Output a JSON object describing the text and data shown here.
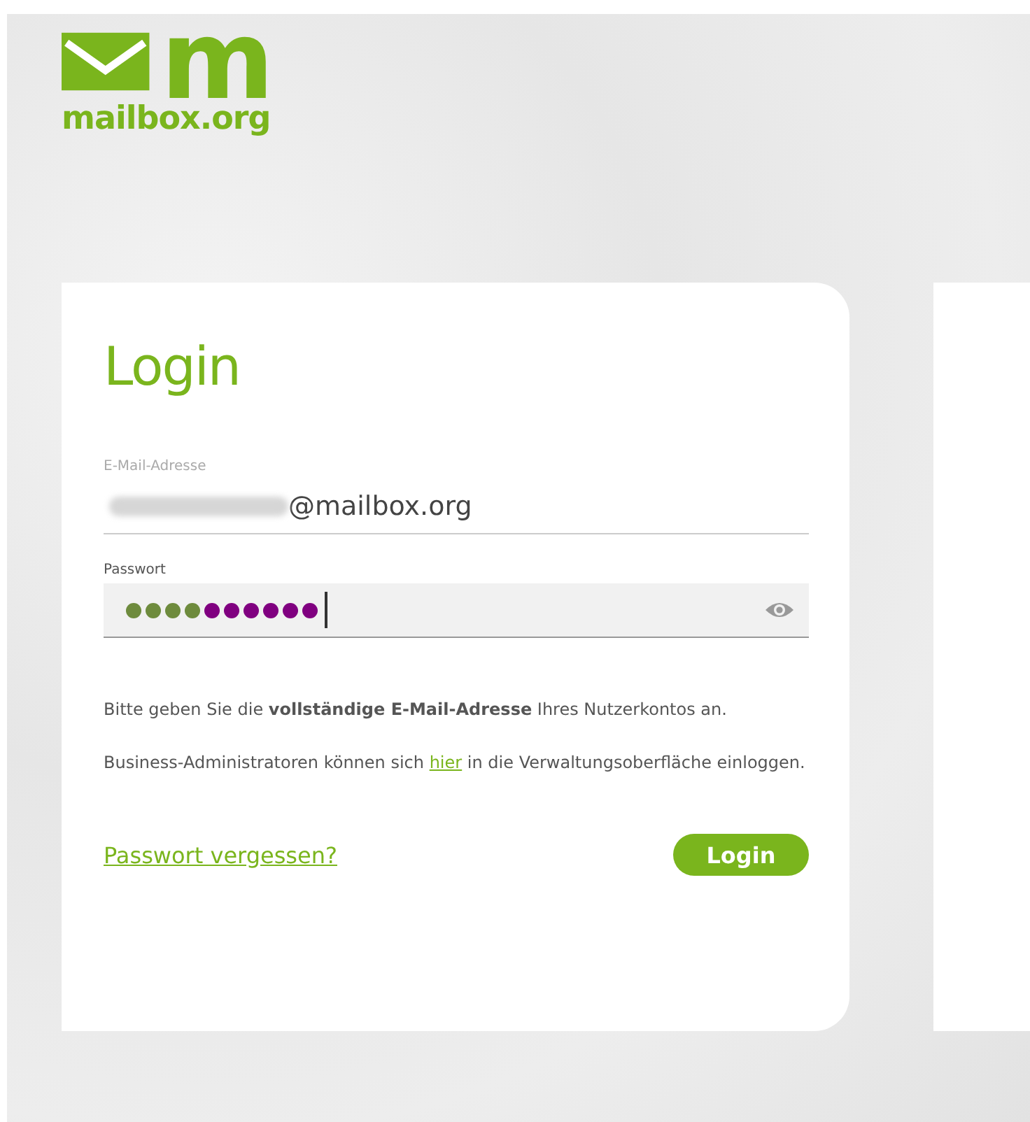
{
  "logo": {
    "letter": "m",
    "wordmark": "mailbox.org"
  },
  "login": {
    "title": "Login",
    "email": {
      "label": "E-Mail-Adresse",
      "value": "@mailbox.org",
      "redacted": true
    },
    "password": {
      "label": "Passwort",
      "focused": true,
      "dots": [
        {
          "color": "#6e8b3d"
        },
        {
          "color": "#6e8b3d"
        },
        {
          "color": "#6e8b3d"
        },
        {
          "color": "#6e8b3d"
        },
        {
          "color": "#800080"
        },
        {
          "color": "#800080"
        },
        {
          "color": "#800080"
        },
        {
          "color": "#800080"
        },
        {
          "color": "#800080"
        },
        {
          "color": "#800080"
        }
      ]
    },
    "hint": "Bitte geben Sie die **vollständige E-Mail-Adresse** Ihres Nutzerkontos an.",
    "admin_text": {
      "before": "Business-Administratoren können sich",
      "link": "hier",
      "after": "in die Verwaltungsoberfläche einloggen."
    },
    "forgot_link": "Passwort vergessen?",
    "submit": "Login"
  }
}
